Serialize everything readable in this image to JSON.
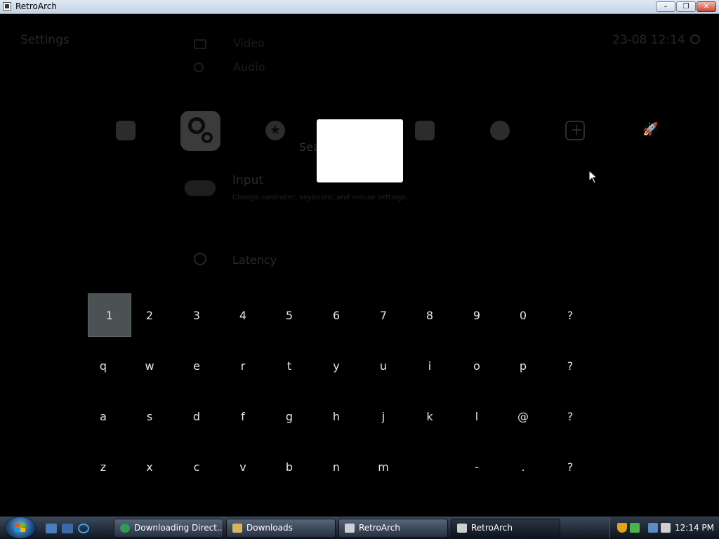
{
  "window": {
    "title": "RetroArch",
    "min_label": "–",
    "max_label": "❐",
    "close_label": "✕"
  },
  "header": {
    "settings_label": "Settings",
    "clock": "23-08 12:14"
  },
  "menu_top": {
    "video": "Video",
    "audio": "Audio"
  },
  "categories": [
    "retroarch-icon",
    "settings-icon",
    "favorites-icon",
    "history-icon",
    "images-icon",
    "netplay-icon",
    "add-icon",
    "rocket-icon"
  ],
  "search": {
    "label": "Search",
    "value": ""
  },
  "input_item": {
    "title": "Input",
    "subtitle": "Change controller, keyboard, and mouse settings."
  },
  "latency_item": {
    "title": "Latency"
  },
  "keyboard": {
    "selected": "1",
    "rows": [
      [
        "1",
        "2",
        "3",
        "4",
        "5",
        "6",
        "7",
        "8",
        "9",
        "0",
        "?"
      ],
      [
        "q",
        "w",
        "e",
        "r",
        "t",
        "y",
        "u",
        "i",
        "o",
        "p",
        "?"
      ],
      [
        "a",
        "s",
        "d",
        "f",
        "g",
        "h",
        "j",
        "k",
        "l",
        "@",
        "?"
      ],
      [
        "z",
        "x",
        "c",
        "v",
        "b",
        "n",
        "m",
        "",
        "-",
        ".",
        "?"
      ]
    ]
  },
  "taskbar": {
    "buttons": [
      {
        "label": "Downloading Direct...",
        "icon": "download-icon"
      },
      {
        "label": "Downloads",
        "icon": "folder-icon"
      },
      {
        "label": "RetroArch",
        "icon": "retroarch-icon"
      },
      {
        "label": "RetroArch",
        "icon": "retroarch-icon"
      }
    ],
    "time": "12:14 PM"
  },
  "colors": {
    "taskbar": "#1b2430",
    "keyboard_selected": "#4a5254",
    "search_box": "#ffffff"
  }
}
